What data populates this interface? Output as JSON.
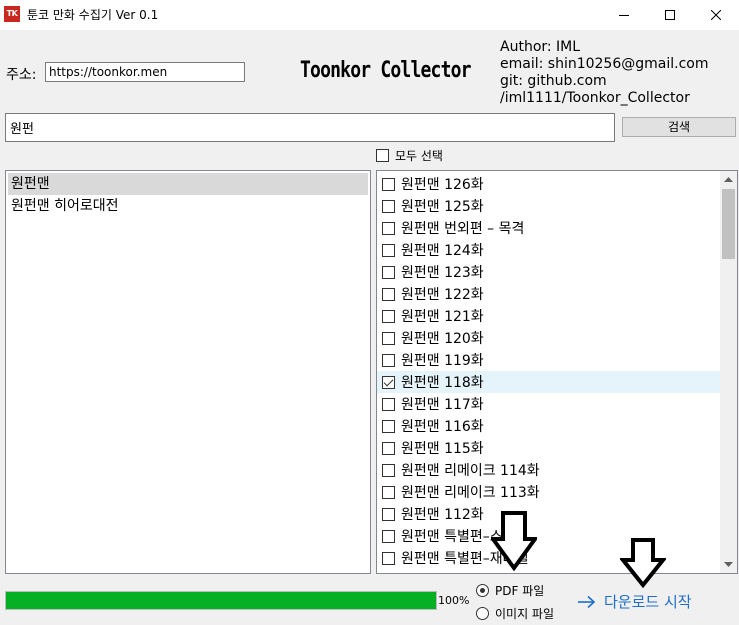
{
  "window": {
    "title": "툰코 만화 수집기 Ver 0.1",
    "icon_text": "TK",
    "controls": [
      "minimize-icon",
      "maximize-icon",
      "close-icon"
    ]
  },
  "address": {
    "label": "주소:",
    "value": "https://toonkor.men"
  },
  "brand": "Toonkor Collector",
  "author_info": "Author: IML\nemail: shin10256@gmail.com\ngit: github.com\n/iml1111/Toonkor_Collector",
  "search": {
    "value": "원펀",
    "button_label": "검색"
  },
  "select_all_label": "모두 선택",
  "results": [
    {
      "label": "원펀맨",
      "selected": true
    },
    {
      "label": "원펀맨 히어로대전",
      "selected": false
    }
  ],
  "episodes": [
    {
      "label": "원펀맨 126화",
      "checked": false
    },
    {
      "label": "원펀맨 125화",
      "checked": false
    },
    {
      "label": "원펀맨 번외편 – 목격",
      "checked": false
    },
    {
      "label": "원펀맨 124화",
      "checked": false
    },
    {
      "label": "원펀맨 123화",
      "checked": false
    },
    {
      "label": "원펀맨 122화",
      "checked": false
    },
    {
      "label": "원펀맨 121화",
      "checked": false
    },
    {
      "label": "원펀맨 120화",
      "checked": false
    },
    {
      "label": "원펀맨 119화",
      "checked": false
    },
    {
      "label": "원펀맨 118화",
      "checked": true,
      "highlighted": true
    },
    {
      "label": "원펀맨 117화",
      "checked": false
    },
    {
      "label": "원펀맨 116화",
      "checked": false
    },
    {
      "label": "원펀맨 115화",
      "checked": false
    },
    {
      "label": "원펀맨 리메이크 114화",
      "checked": false
    },
    {
      "label": "원펀맨 리메이크 113화",
      "checked": false
    },
    {
      "label": "원펀맨 112화",
      "checked": false
    },
    {
      "label": "원펀맨 특별편–스타",
      "checked": false
    },
    {
      "label": "원펀맨 특별편–재레벨",
      "checked": false
    }
  ],
  "progress": {
    "value": 1.0,
    "text": "100%",
    "color": "#06b025"
  },
  "format_options": [
    {
      "label": "PDF 파일",
      "selected": true
    },
    {
      "label": "이미지 파일",
      "selected": false
    }
  ],
  "download_button": {
    "icon": "arrow-right-icon",
    "label": "다운로드 시작",
    "color": "#1e6ec8"
  }
}
